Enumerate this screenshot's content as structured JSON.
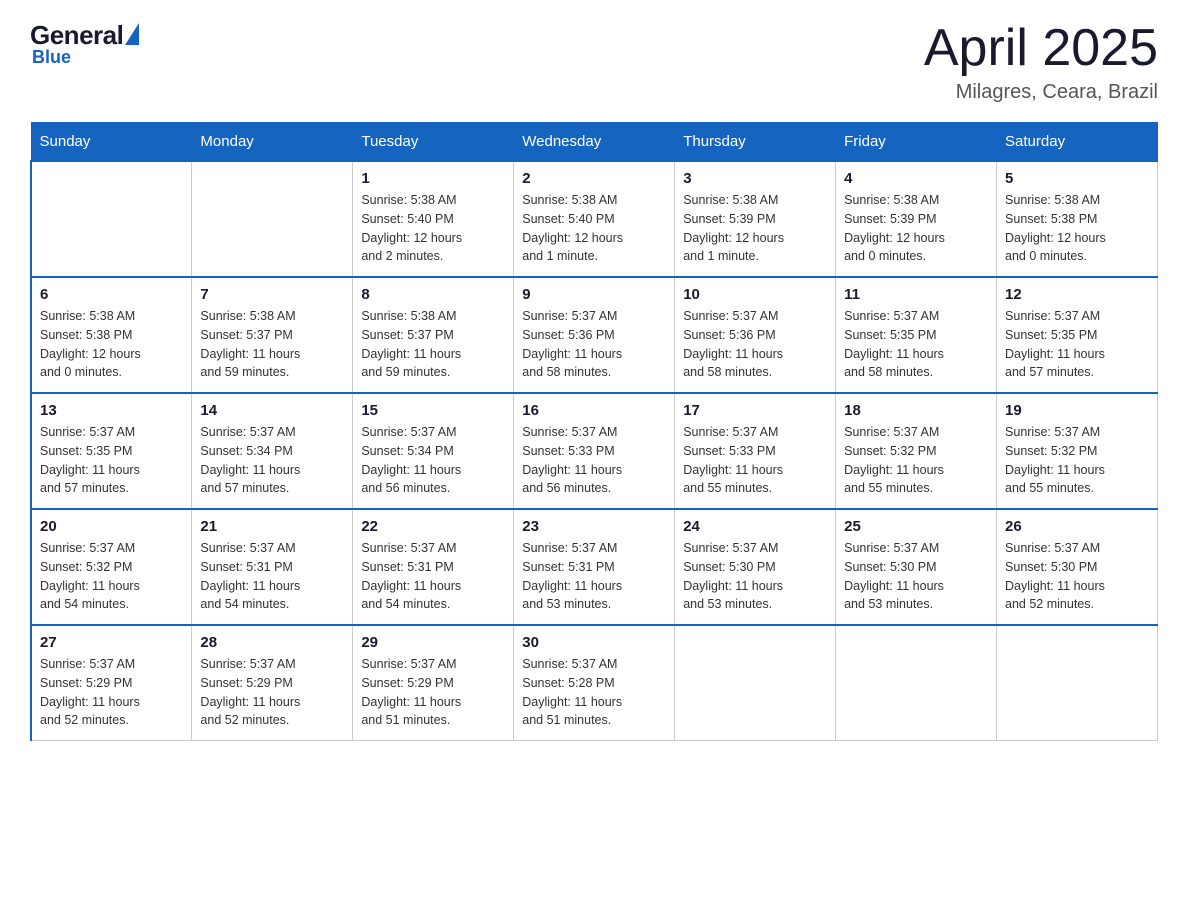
{
  "logo": {
    "general": "General",
    "blue": "Blue"
  },
  "header": {
    "title": "April 2025",
    "location": "Milagres, Ceara, Brazil"
  },
  "weekdays": [
    "Sunday",
    "Monday",
    "Tuesday",
    "Wednesday",
    "Thursday",
    "Friday",
    "Saturday"
  ],
  "weeks": [
    [
      {
        "day": "",
        "info": ""
      },
      {
        "day": "",
        "info": ""
      },
      {
        "day": "1",
        "info": "Sunrise: 5:38 AM\nSunset: 5:40 PM\nDaylight: 12 hours\nand 2 minutes."
      },
      {
        "day": "2",
        "info": "Sunrise: 5:38 AM\nSunset: 5:40 PM\nDaylight: 12 hours\nand 1 minute."
      },
      {
        "day": "3",
        "info": "Sunrise: 5:38 AM\nSunset: 5:39 PM\nDaylight: 12 hours\nand 1 minute."
      },
      {
        "day": "4",
        "info": "Sunrise: 5:38 AM\nSunset: 5:39 PM\nDaylight: 12 hours\nand 0 minutes."
      },
      {
        "day": "5",
        "info": "Sunrise: 5:38 AM\nSunset: 5:38 PM\nDaylight: 12 hours\nand 0 minutes."
      }
    ],
    [
      {
        "day": "6",
        "info": "Sunrise: 5:38 AM\nSunset: 5:38 PM\nDaylight: 12 hours\nand 0 minutes."
      },
      {
        "day": "7",
        "info": "Sunrise: 5:38 AM\nSunset: 5:37 PM\nDaylight: 11 hours\nand 59 minutes."
      },
      {
        "day": "8",
        "info": "Sunrise: 5:38 AM\nSunset: 5:37 PM\nDaylight: 11 hours\nand 59 minutes."
      },
      {
        "day": "9",
        "info": "Sunrise: 5:37 AM\nSunset: 5:36 PM\nDaylight: 11 hours\nand 58 minutes."
      },
      {
        "day": "10",
        "info": "Sunrise: 5:37 AM\nSunset: 5:36 PM\nDaylight: 11 hours\nand 58 minutes."
      },
      {
        "day": "11",
        "info": "Sunrise: 5:37 AM\nSunset: 5:35 PM\nDaylight: 11 hours\nand 58 minutes."
      },
      {
        "day": "12",
        "info": "Sunrise: 5:37 AM\nSunset: 5:35 PM\nDaylight: 11 hours\nand 57 minutes."
      }
    ],
    [
      {
        "day": "13",
        "info": "Sunrise: 5:37 AM\nSunset: 5:35 PM\nDaylight: 11 hours\nand 57 minutes."
      },
      {
        "day": "14",
        "info": "Sunrise: 5:37 AM\nSunset: 5:34 PM\nDaylight: 11 hours\nand 57 minutes."
      },
      {
        "day": "15",
        "info": "Sunrise: 5:37 AM\nSunset: 5:34 PM\nDaylight: 11 hours\nand 56 minutes."
      },
      {
        "day": "16",
        "info": "Sunrise: 5:37 AM\nSunset: 5:33 PM\nDaylight: 11 hours\nand 56 minutes."
      },
      {
        "day": "17",
        "info": "Sunrise: 5:37 AM\nSunset: 5:33 PM\nDaylight: 11 hours\nand 55 minutes."
      },
      {
        "day": "18",
        "info": "Sunrise: 5:37 AM\nSunset: 5:32 PM\nDaylight: 11 hours\nand 55 minutes."
      },
      {
        "day": "19",
        "info": "Sunrise: 5:37 AM\nSunset: 5:32 PM\nDaylight: 11 hours\nand 55 minutes."
      }
    ],
    [
      {
        "day": "20",
        "info": "Sunrise: 5:37 AM\nSunset: 5:32 PM\nDaylight: 11 hours\nand 54 minutes."
      },
      {
        "day": "21",
        "info": "Sunrise: 5:37 AM\nSunset: 5:31 PM\nDaylight: 11 hours\nand 54 minutes."
      },
      {
        "day": "22",
        "info": "Sunrise: 5:37 AM\nSunset: 5:31 PM\nDaylight: 11 hours\nand 54 minutes."
      },
      {
        "day": "23",
        "info": "Sunrise: 5:37 AM\nSunset: 5:31 PM\nDaylight: 11 hours\nand 53 minutes."
      },
      {
        "day": "24",
        "info": "Sunrise: 5:37 AM\nSunset: 5:30 PM\nDaylight: 11 hours\nand 53 minutes."
      },
      {
        "day": "25",
        "info": "Sunrise: 5:37 AM\nSunset: 5:30 PM\nDaylight: 11 hours\nand 53 minutes."
      },
      {
        "day": "26",
        "info": "Sunrise: 5:37 AM\nSunset: 5:30 PM\nDaylight: 11 hours\nand 52 minutes."
      }
    ],
    [
      {
        "day": "27",
        "info": "Sunrise: 5:37 AM\nSunset: 5:29 PM\nDaylight: 11 hours\nand 52 minutes."
      },
      {
        "day": "28",
        "info": "Sunrise: 5:37 AM\nSunset: 5:29 PM\nDaylight: 11 hours\nand 52 minutes."
      },
      {
        "day": "29",
        "info": "Sunrise: 5:37 AM\nSunset: 5:29 PM\nDaylight: 11 hours\nand 51 minutes."
      },
      {
        "day": "30",
        "info": "Sunrise: 5:37 AM\nSunset: 5:28 PM\nDaylight: 11 hours\nand 51 minutes."
      },
      {
        "day": "",
        "info": ""
      },
      {
        "day": "",
        "info": ""
      },
      {
        "day": "",
        "info": ""
      }
    ]
  ]
}
